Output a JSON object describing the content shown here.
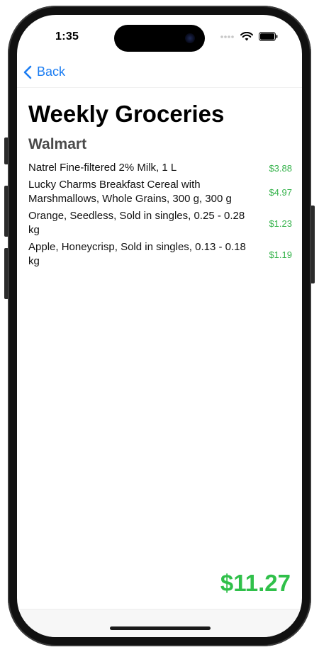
{
  "status_bar": {
    "time": "1:35"
  },
  "nav": {
    "back_label": "Back"
  },
  "page": {
    "title": "Weekly Groceries",
    "store": "Walmart"
  },
  "items": [
    {
      "name": "Natrel Fine-filtered 2% Milk, 1 L",
      "price": "$3.88"
    },
    {
      "name": "Lucky Charms Breakfast Cereal with Marshmallows, Whole Grains, 300 g, 300 g",
      "price": "$4.97"
    },
    {
      "name": "Orange, Seedless, Sold in singles, 0.25 - 0.28 kg",
      "price": "$1.23"
    },
    {
      "name": "Apple, Honeycrisp, Sold in singles, 0.13 - 0.18 kg",
      "price": "$1.19"
    }
  ],
  "total": "$11.27",
  "colors": {
    "accent": "#1a7cf2",
    "price_green": "#34b24a",
    "total_green": "#30c04a"
  },
  "icons": {
    "back": "chevron-left-icon",
    "signal": "cellular-signal-icon",
    "wifi": "wifi-icon",
    "battery": "battery-icon"
  }
}
